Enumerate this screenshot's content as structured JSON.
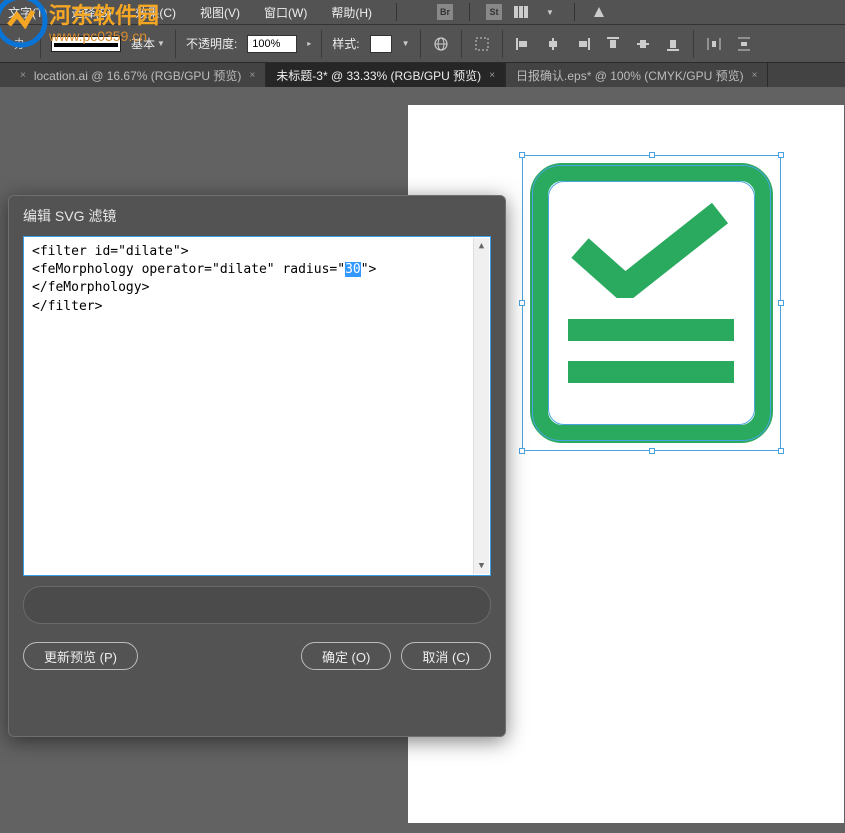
{
  "menu": {
    "items": [
      "文字(T)",
      "选择(S)",
      "效果(C)",
      "视图(V)",
      "窗口(W)",
      "帮助(H)"
    ]
  },
  "toolbar": {
    "stroke_style": "基本",
    "opacity_label": "不透明度:",
    "opacity_value": "100%",
    "style_label": "样式:"
  },
  "tabs": [
    {
      "label": "location.ai @ 16.67% (RGB/GPU 预览)",
      "active": false,
      "closable": true
    },
    {
      "label": "未标题-3* @ 33.33% (RGB/GPU 预览)",
      "active": true,
      "closable": true
    },
    {
      "label": "日报确认.eps* @ 100% (CMYK/GPU 预览)",
      "active": false,
      "closable": true
    }
  ],
  "dialog": {
    "title": "编辑 SVG 滤镜",
    "code_line1": "<filter id=\"dilate\">",
    "code_line2a": "<feMorphology operator=\"dilate\" radius=\"",
    "code_selected": "30",
    "code_line2b": "\"></feMorphology>",
    "code_line3": "</filter>",
    "update_preview": "更新预览 (P)",
    "ok": "确定 (O)",
    "cancel": "取消 (C)"
  },
  "watermarks": {
    "site_text": "河东软件园",
    "site_url": "www.pc0359.cn"
  }
}
